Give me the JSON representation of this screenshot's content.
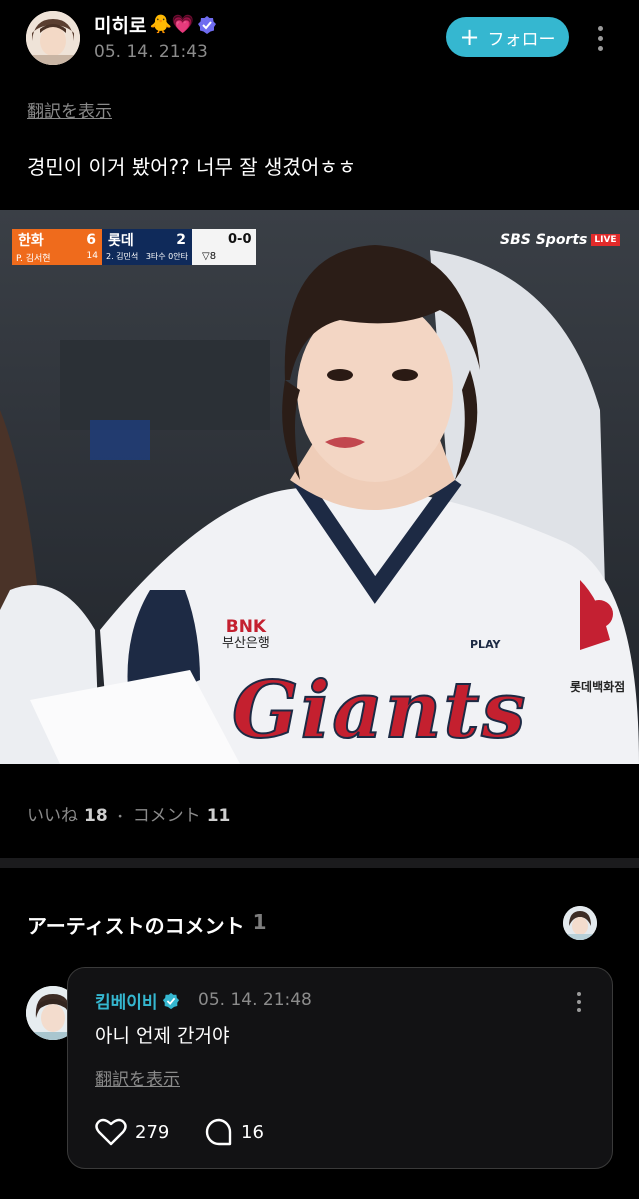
{
  "post": {
    "author": {
      "name": "미히로",
      "emoji": "🐥💗"
    },
    "timestamp": "05. 14. 21:43",
    "follow_label": "フォロー",
    "translate_label": "翻訳を表示",
    "text": "경민이 이거 봤어?? 너무 잘 생겼어ㅎㅎ",
    "image": {
      "broadcaster": "SBS Sports",
      "live_badge": "LIVE",
      "scoreboard": {
        "home_team": "한화",
        "home_score": "6",
        "away_team": "롯데",
        "away_score": "2",
        "count": "0-0",
        "inning": "▽8",
        "pitcher": "P. 김서현",
        "pitch_count": "14",
        "batter": "2. 김민석",
        "batter_stat": "3타수 0안타"
      },
      "jersey_text": "Giants",
      "sponsor_text": "BNK",
      "sponsor_sub": "부산은행",
      "brand_text": "PLAY",
      "sleeve_text": "롯데백화점"
    },
    "stats": {
      "likes_label": "いいね",
      "likes_count": "18",
      "separator": "・",
      "comments_label": "コメント",
      "comments_count": "11"
    }
  },
  "artist_comments": {
    "title": "アーティストのコメント",
    "count": "1",
    "comment": {
      "author": "킴베이비",
      "timestamp": "05. 14. 21:48",
      "text": "아니 언제 간거야",
      "translate_label": "翻訳を表示",
      "likes": "279",
      "replies": "16"
    }
  },
  "colors": {
    "accent": "#35b7d0",
    "background": "#000000",
    "card": "#121214"
  },
  "icons": [
    "plus-icon",
    "more-icon",
    "verified-badge-icon",
    "heart-icon",
    "comment-icon"
  ]
}
